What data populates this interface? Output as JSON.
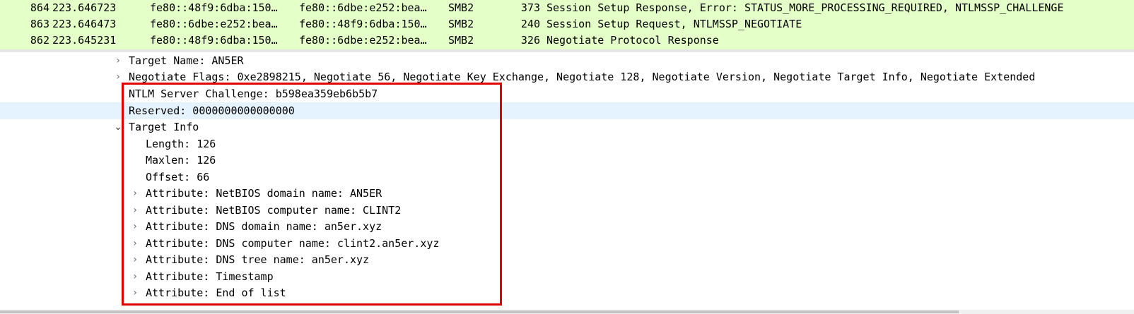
{
  "packet_list": {
    "background_color": "#e4ffc7",
    "rows": [
      {
        "no": "864",
        "time": "223.646723",
        "source": "fe80::48f9:6dba:150…",
        "destination": "fe80::6dbe:e252:bea…",
        "protocol": "SMB2",
        "length": "373",
        "info": "Session Setup Response, Error: STATUS_MORE_PROCESSING_REQUIRED, NTLMSSP_CHALLENGE"
      },
      {
        "no": "863",
        "time": "223.646473",
        "source": "fe80::6dbe:e252:bea…",
        "destination": "fe80::48f9:6dba:150…",
        "protocol": "SMB2",
        "length": "240",
        "info": "Session Setup Request, NTLMSSP_NEGOTIATE"
      },
      {
        "no": "862",
        "time": "223.645231",
        "source": "fe80::48f9:6dba:150…",
        "destination": "fe80::6dbe:e252:bea…",
        "protocol": "SMB2",
        "length": "326",
        "info": "Negotiate Protocol Response"
      }
    ]
  },
  "details": {
    "target_name": "Target Name: AN5ER",
    "negotiate_flags": "Negotiate Flags: 0xe2898215, Negotiate 56, Negotiate Key Exchange, Negotiate 128, Negotiate Version, Negotiate Target Info, Negotiate Extended",
    "server_challenge": "NTLM Server Challenge: b598ea359eb6b5b7",
    "reserved": "Reserved: 0000000000000000",
    "target_info": {
      "label": "Target Info",
      "length": "Length: 126",
      "maxlen": "Maxlen: 126",
      "offset": "Offset: 66",
      "attributes": [
        "Attribute: NetBIOS domain name: AN5ER",
        "Attribute: NetBIOS computer name: CLINT2",
        "Attribute: DNS domain name: an5er.xyz",
        "Attribute: DNS computer name: clint2.an5er.xyz",
        "Attribute: DNS tree name: an5er.xyz",
        "Attribute: Timestamp",
        "Attribute: End of list"
      ]
    }
  },
  "icons": {
    "collapsed": "chevron-right-icon",
    "expanded": "chevron-down-icon"
  },
  "colors": {
    "selected_row": "#e5f3ff",
    "annotation_border": "#e00000"
  }
}
